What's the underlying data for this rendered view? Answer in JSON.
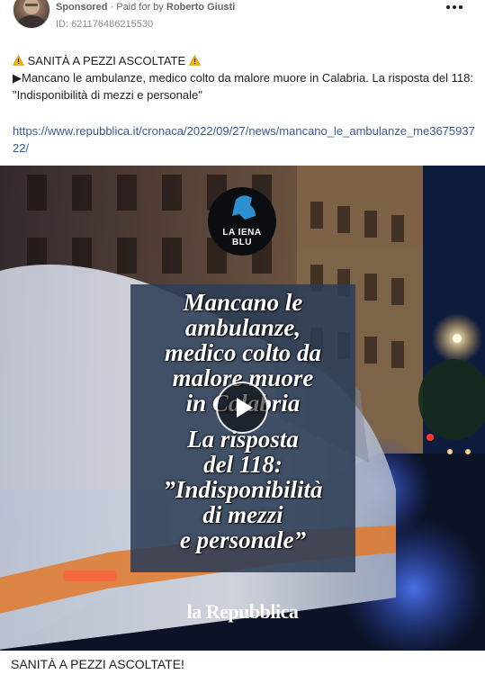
{
  "post": {
    "sponsored_label": "Sponsored",
    "paid_prefix": " · Paid for by ",
    "advertiser": "Roberto Giusti",
    "ad_id": "ID: 621176486215530",
    "more_icon": "more-horizontal-icon",
    "body_line1": "SANITÀ A PEZZI ASCOLTATE",
    "body_line2": "▶Mancano le ambulanze, medico colto da malore muore in Calabria. La risposta del 118: \"Indisponibilità di mezzi e personale\"",
    "link": "https://www.repubblica.it/cronaca/2022/09/27/news/mancano_le_ambulanze_me367593722/",
    "caption": "SANITÀ A PEZZI ASCOLTATE!"
  },
  "media": {
    "logo_line1": "LA IENA BLU",
    "headline_lines": [
      "Mancano le",
      "ambulanze,",
      "medico colto da",
      "malore muore",
      "in Calabria"
    ],
    "response_lines": [
      "La risposta",
      "del 118:",
      "”Indisponibilità",
      "di mezzi",
      "e personale”"
    ],
    "source": "la Repubblica",
    "play_icon": "play-icon"
  },
  "colors": {
    "link": "#385898",
    "overlay_box": "#2c3e56",
    "night_sky": "#0b1a3a"
  }
}
